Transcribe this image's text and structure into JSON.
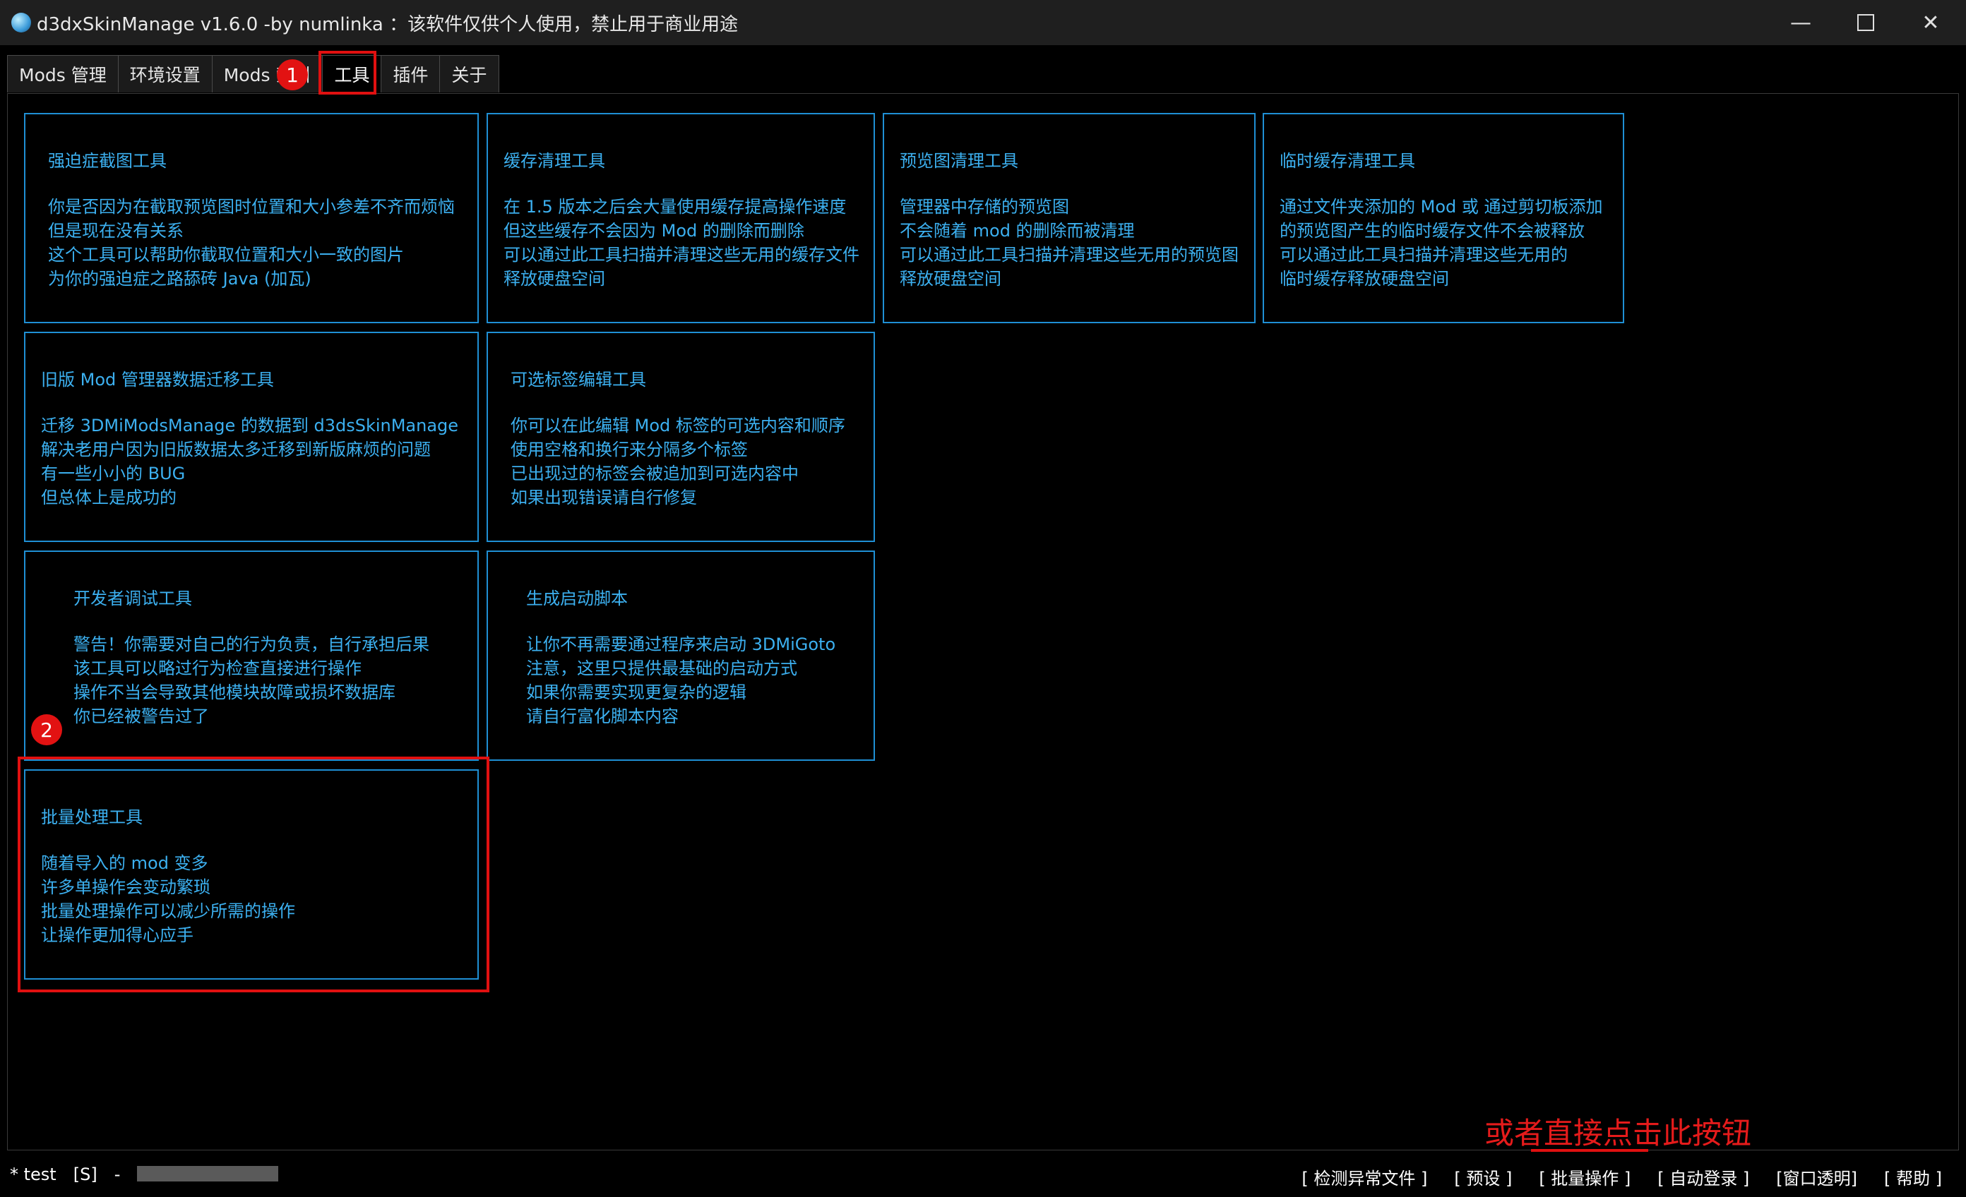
{
  "window": {
    "title": "d3dxSkinManage v1.6.0 -by numlinka ：该软件仅供个人使用，禁止用于商业用途",
    "minimize": "—",
    "close": "✕"
  },
  "tabs": [
    {
      "label": "Mods 管理"
    },
    {
      "label": "环境设置"
    },
    {
      "label": "Mods 索引"
    },
    {
      "label": "工具",
      "active": true
    },
    {
      "label": "插件"
    },
    {
      "label": "关于"
    }
  ],
  "cards": [
    {
      "title": "强迫症截图工具",
      "lines": [
        "你是否因为在截取预览图时位置和大小参差不齐而烦恼",
        "但是现在没有关系",
        "这个工具可以帮助你截取位置和大小一致的图片",
        "为你的强迫症之路舔砖 Java (加瓦)"
      ]
    },
    {
      "title": "缓存清理工具",
      "lines": [
        "在 1.5 版本之后会大量使用缓存提高操作速度",
        "但这些缓存不会因为 Mod 的删除而删除",
        "可以通过此工具扫描并清理这些无用的缓存文件",
        "释放硬盘空间"
      ]
    },
    {
      "title": "预览图清理工具",
      "lines": [
        "管理器中存储的预览图",
        "不会随着 mod 的删除而被清理",
        "可以通过此工具扫描并清理这些无用的预览图",
        "释放硬盘空间"
      ]
    },
    {
      "title": "临时缓存清理工具",
      "lines": [
        "通过文件夹添加的 Mod 或 通过剪切板添加",
        "的预览图产生的临时缓存文件不会被释放",
        "可以通过此工具扫描并清理这些无用的",
        "临时缓存释放硬盘空间"
      ]
    },
    {
      "title": "旧版 Mod 管理器数据迁移工具",
      "lines": [
        "迁移 3DMiModsManage 的数据到 d3dsSkinManage",
        "解决老用户因为旧版数据太多迁移到新版麻烦的问题",
        "有一些小小的 BUG",
        "但总体上是成功的"
      ]
    },
    {
      "title": "可选标签编辑工具",
      "lines": [
        "你可以在此编辑 Mod 标签的可选内容和顺序",
        "使用空格和换行来分隔多个标签",
        "已出现过的标签会被追加到可选内容中",
        "如果出现错误请自行修复"
      ]
    },
    {
      "title": "开发者调试工具",
      "lines": [
        "警告！你需要对自己的行为负责，自行承担后果",
        "该工具可以略过行为检查直接进行操作",
        "操作不当会导致其他模块故障或损坏数据库",
        "你已经被警告过了"
      ]
    },
    {
      "title": "生成启动脚本",
      "lines": [
        "让你不再需要通过程序来启动 3DMiGoto",
        "注意，这里只提供最基础的启动方式",
        "如果你需要实现更复杂的逻辑",
        "请自行富化脚本内容"
      ]
    },
    {
      "title": "批量处理工具",
      "lines": [
        "随着导入的 mod 变多",
        "许多单操作会变动繁琐",
        "批量处理操作可以减少所需的操作",
        "让操作更加得心应手"
      ]
    }
  ],
  "annotations": {
    "num1": "1",
    "num2": "2",
    "note": "或者直接点击此按钮",
    "color": "#e01010"
  },
  "status": {
    "user": "* test",
    "flag": "[S]",
    "dash": "-",
    "links": [
      "[ 检测异常文件 ]",
      "[ 预设 ]",
      "[ 批量操作 ]",
      "[ 自动登录 ]",
      "[窗口透明]",
      "[ 帮助 ]"
    ]
  },
  "colors": {
    "card_border": "#1f8fd4",
    "card_text": "#3cb0f0",
    "background": "#000000"
  }
}
